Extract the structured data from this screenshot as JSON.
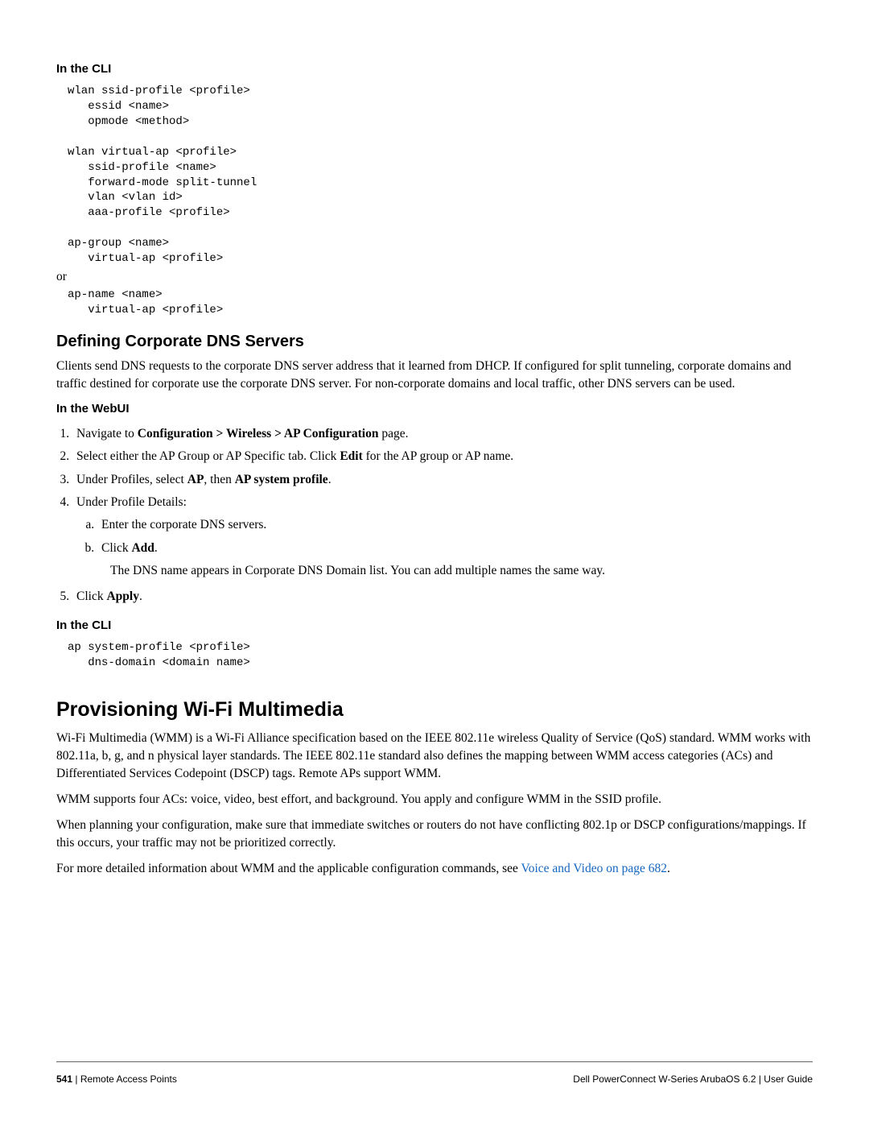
{
  "headings": {
    "cli1": "In the CLI",
    "dns": "Defining Corporate DNS Servers",
    "webui": "In the WebUI",
    "cli2": "In the CLI",
    "wifi": "Provisioning Wi-Fi Multimedia"
  },
  "code": {
    "block1": "wlan ssid-profile <profile>\n   essid <name>\n   opmode <method>\n\nwlan virtual-ap <profile>\n   ssid-profile <name>\n   forward-mode split-tunnel\n   vlan <vlan id>\n   aaa-profile <profile>\n\nap-group <name>\n   virtual-ap <profile>",
    "or": "or",
    "block2": "ap-name <name>\n   virtual-ap <profile>",
    "block3": "ap system-profile <profile>\n   dns-domain <domain name>"
  },
  "paragraphs": {
    "dns_intro": "Clients send DNS requests to the corporate DNS server address that it learned from DHCP. If configured for split tunneling, corporate domains and traffic destined for corporate use the corporate DNS server. For non-corporate domains and local traffic, other DNS servers can be used.",
    "wifi_p1": "Wi-Fi Multimedia (WMM) is a Wi-Fi Alliance specification based on the IEEE 802.11e wireless Quality of Service (QoS) standard. WMM works with 802.11a, b, g, and n physical layer standards. The IEEE 802.11e standard also defines the mapping between WMM access categories (ACs) and Differentiated Services Codepoint (DSCP) tags. Remote APs support WMM.",
    "wifi_p2": "WMM supports four ACs: voice, video, best effort, and background. You apply and configure WMM in the SSID profile.",
    "wifi_p3": "When planning your configuration, make sure that immediate switches or routers do not have conflicting 802.1p or DSCP configurations/mappings. If this occurs, your traffic may not be prioritized correctly.",
    "wifi_p4_pre": "For more detailed information about WMM and the applicable configuration commands, see ",
    "wifi_p4_link": "Voice and Video on page 682",
    "wifi_p4_post": "."
  },
  "steps": {
    "s1_pre": "Navigate to ",
    "s1_b": "Configuration > Wireless > AP Configuration",
    "s1_post": " page.",
    "s2_pre": "Select either the AP Group or AP Specific tab. Click ",
    "s2_b": "Edit",
    "s2_post": " for the AP group or AP name.",
    "s3_pre": "Under Profiles, select ",
    "s3_b1": "AP",
    "s3_mid": ", then ",
    "s3_b2": "AP system profile",
    "s3_post": ".",
    "s4": "Under Profile Details:",
    "s4a": "Enter the corporate DNS servers.",
    "s4b_pre": "Click ",
    "s4b_b": "Add",
    "s4b_post": ".",
    "s4b_note": "The DNS name appears in Corporate DNS Domain list. You can add multiple names the same way.",
    "s5_pre": "Click ",
    "s5_b": "Apply",
    "s5_post": "."
  },
  "footer": {
    "pagenum": "541",
    "left": "Remote Access Points",
    "right_pre": "Dell PowerConnect W-Series ArubaOS 6.2",
    "right_post": "User Guide"
  }
}
